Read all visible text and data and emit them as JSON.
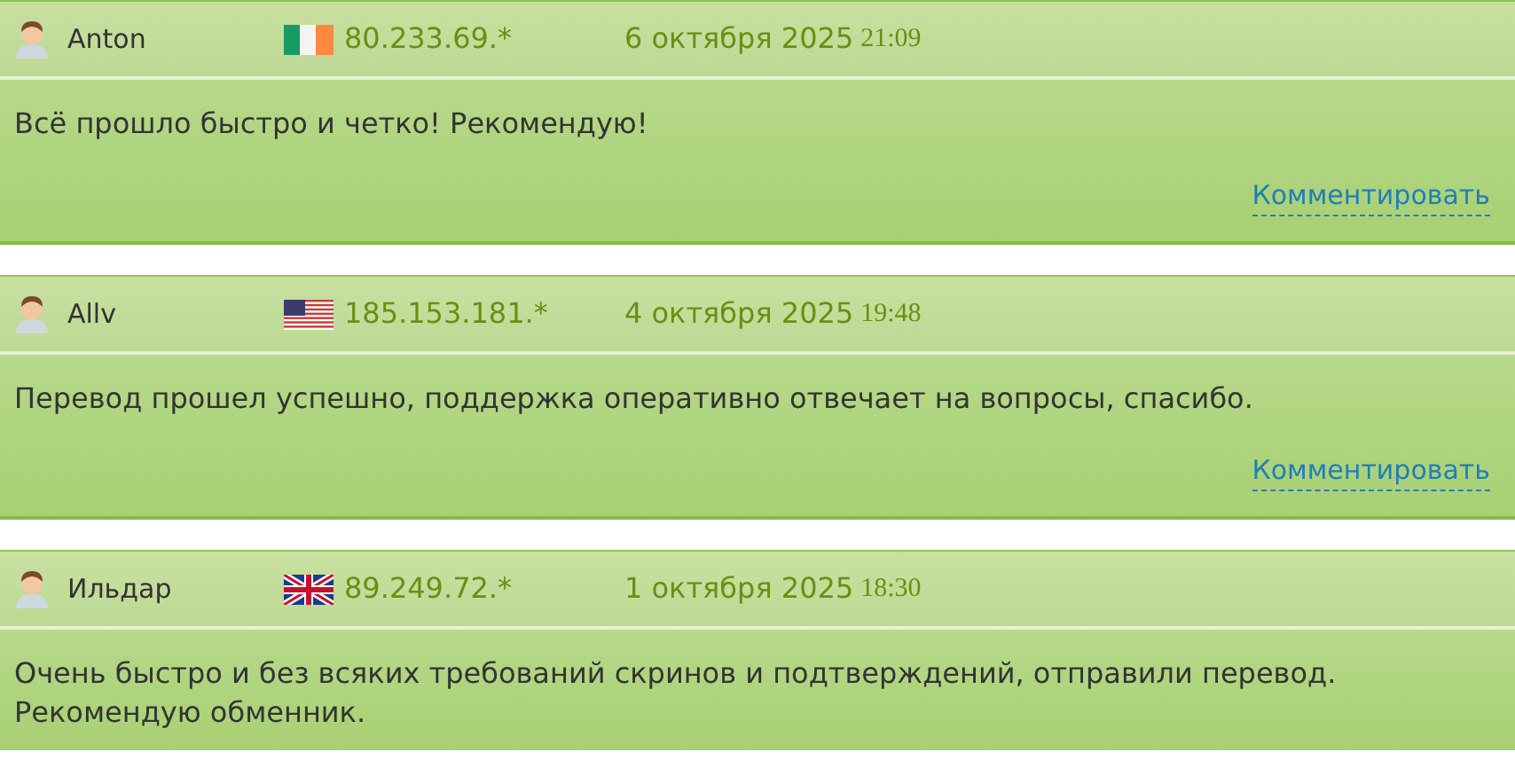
{
  "reviews": [
    {
      "author": "Anton",
      "kind": "ie",
      "ip": "80.233.69.*",
      "date": "6 октября 2025",
      "time": "21:09",
      "text": "Всё прошло быстро и четко! Рекомендую!",
      "comment_link": "Комментировать"
    },
    {
      "author": "Allv",
      "kind": "us",
      "ip": "185.153.181.*",
      "date": "4 октября 2025",
      "time": "19:48",
      "text": "Перевод прошел успешно, поддержка оперативно отвечает на вопросы, спасибо.",
      "comment_link": "Комментировать"
    },
    {
      "author": "Ильдар",
      "kind": "gb",
      "ip": "89.249.72.*",
      "date": "1 октября 2025",
      "time": "18:30",
      "text": "Очень быстро и без всяких требований скринов и подтверждений, отправили перевод. Рекомендую обменник."
    }
  ]
}
